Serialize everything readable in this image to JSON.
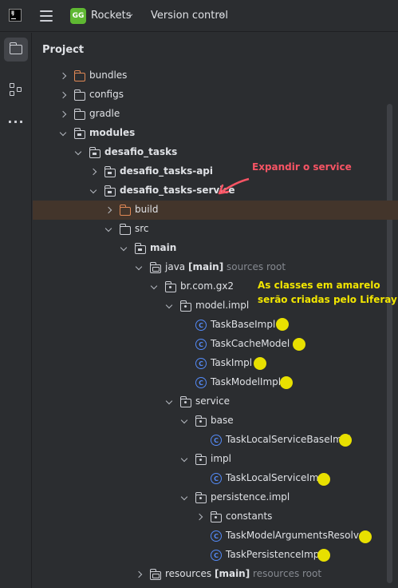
{
  "titlebar": {
    "project_badge": "GG",
    "project_name": "Rockets",
    "vcs_label": "Version control"
  },
  "panel": {
    "title": "Project"
  },
  "tree": [
    {
      "label": "bundles",
      "hint": "",
      "tag": "",
      "bold": false,
      "icon": "folder-orange",
      "arrow": "right"
    },
    {
      "label": "configs",
      "hint": "",
      "tag": "",
      "bold": false,
      "icon": "folder",
      "arrow": "right"
    },
    {
      "label": "gradle",
      "hint": "",
      "tag": "",
      "bold": false,
      "icon": "folder",
      "arrow": "right"
    },
    {
      "label": "modules",
      "hint": "",
      "tag": "",
      "bold": true,
      "icon": "module-folder",
      "arrow": "down"
    },
    {
      "label": "desafio_tasks",
      "hint": "",
      "tag": "",
      "bold": true,
      "icon": "module-folder",
      "arrow": "down"
    },
    {
      "label": "desafio_tasks-api",
      "hint": "",
      "tag": "",
      "bold": true,
      "icon": "module-folder",
      "arrow": "right"
    },
    {
      "label": "desafio_tasks-service",
      "hint": "",
      "tag": "",
      "bold": true,
      "icon": "module-folder",
      "arrow": "down"
    },
    {
      "label": "build",
      "hint": "",
      "tag": "",
      "bold": false,
      "icon": "folder-orange",
      "arrow": "right"
    },
    {
      "label": "src",
      "hint": "",
      "tag": "",
      "bold": false,
      "icon": "folder",
      "arrow": "down"
    },
    {
      "label": "main",
      "hint": "",
      "tag": "",
      "bold": true,
      "icon": "module-folder",
      "arrow": "down"
    },
    {
      "label": "java",
      "tag": "[main]",
      "hint": "sources root",
      "bold": false,
      "icon": "source-folder",
      "arrow": "down"
    },
    {
      "label": "br.com.gx2",
      "hint": "",
      "tag": "",
      "bold": false,
      "icon": "package",
      "arrow": "down"
    },
    {
      "label": "model.impl",
      "hint": "",
      "tag": "",
      "bold": false,
      "icon": "package",
      "arrow": "down"
    },
    {
      "label": "TaskBaseImpl",
      "hint": "",
      "tag": "",
      "bold": false,
      "icon": "class",
      "arrow": "none"
    },
    {
      "label": "TaskCacheModel",
      "hint": "",
      "tag": "",
      "bold": false,
      "icon": "class",
      "arrow": "none"
    },
    {
      "label": "TaskImpl",
      "hint": "",
      "tag": "",
      "bold": false,
      "icon": "class",
      "arrow": "none"
    },
    {
      "label": "TaskModelImpl",
      "hint": "",
      "tag": "",
      "bold": false,
      "icon": "class",
      "arrow": "none"
    },
    {
      "label": "service",
      "hint": "",
      "tag": "",
      "bold": false,
      "icon": "package",
      "arrow": "down"
    },
    {
      "label": "base",
      "hint": "",
      "tag": "",
      "bold": false,
      "icon": "package",
      "arrow": "down"
    },
    {
      "label": "TaskLocalServiceBaseImpl",
      "hint": "",
      "tag": "",
      "bold": false,
      "icon": "class",
      "arrow": "none"
    },
    {
      "label": "impl",
      "hint": "",
      "tag": "",
      "bold": false,
      "icon": "package",
      "arrow": "down"
    },
    {
      "label": "TaskLocalServiceImpl",
      "hint": "",
      "tag": "",
      "bold": false,
      "icon": "class",
      "arrow": "none"
    },
    {
      "label": "persistence.impl",
      "hint": "",
      "tag": "",
      "bold": false,
      "icon": "package",
      "arrow": "down"
    },
    {
      "label": "constants",
      "hint": "",
      "tag": "",
      "bold": false,
      "icon": "package",
      "arrow": "right"
    },
    {
      "label": "TaskModelArgumentsResolver",
      "hint": "",
      "tag": "",
      "bold": false,
      "icon": "class",
      "arrow": "none"
    },
    {
      "label": "TaskPersistenceImpl",
      "hint": "",
      "tag": "",
      "bold": false,
      "icon": "class",
      "arrow": "none"
    },
    {
      "label": "resources",
      "tag": "[main]",
      "hint": "resources root",
      "bold": false,
      "icon": "resources-folder",
      "arrow": "right"
    }
  ],
  "annotations": {
    "expand_note": "Expandir o service",
    "yellow_note_line1": "As classes em amarelo",
    "yellow_note_line2": "serão criadas pelo Liferay",
    "note_red_color": "#f75464",
    "note_yellow_color": "#f2e600",
    "marker_color": "#e8e000"
  },
  "colors": {
    "background": "#2b2d30",
    "selected_row": "#43352b",
    "class_icon": "#548af7",
    "excluded_folder": "#e08855",
    "project_badge": "#5fb832"
  }
}
